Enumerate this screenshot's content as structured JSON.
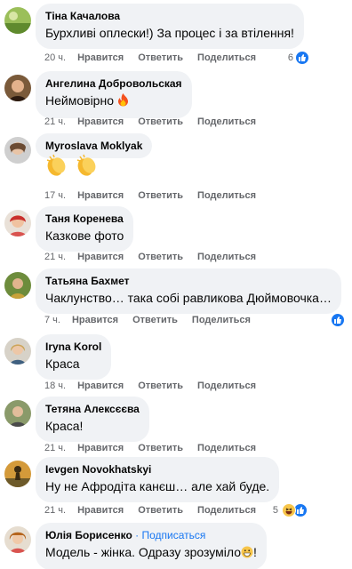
{
  "colors": {
    "bubble_bg": "#f0f2f5",
    "action_text": "#65676b",
    "like_blue": "#1877f2",
    "follow_link": "#1877f2"
  },
  "actions": {
    "like": "Нравится",
    "reply": "Ответить",
    "share": "Поделиться"
  },
  "comments": [
    {
      "author": "Тіна Качалова",
      "text": "Бурхливі оплески!) За процес і за втілення!",
      "time": "20 ч.",
      "reactions_count": "6",
      "reaction_icons": [
        "like-icon"
      ],
      "avatar_icon": "avatar-green-landscape"
    },
    {
      "author": "Ангелина Добровольская",
      "text": "Неймовірно",
      "text_emoji": "fire-icon",
      "time": "21 ч.",
      "avatar_icon": "avatar-woman-dark-hair"
    },
    {
      "author": "Myroslava Moklyak",
      "text": "",
      "text_emoji": "clapping-hands-icon x2",
      "time": "17 ч.",
      "avatar_icon": "avatar-woman-portrait"
    },
    {
      "author": "Таня Коренева",
      "text": "Казкове фото",
      "time": "21 ч.",
      "avatar_icon": "avatar-woman-red"
    },
    {
      "author": "Татьяна Бахмет",
      "text": "Чаклунство… така собі равликова Дюймовочка…",
      "time": "7 ч.",
      "reaction_icons": [
        "like-icon"
      ],
      "avatar_icon": "avatar-woman-outdoor"
    },
    {
      "author": "Iryna Korol",
      "text": "Краса",
      "time": "18 ч.",
      "avatar_icon": "avatar-woman-blonde"
    },
    {
      "author": "Тетяна Алексєєва",
      "text": "Краса!",
      "time": "21 ч.",
      "avatar_icon": "avatar-woman-garden"
    },
    {
      "author": "Ievgen Novokhatskyi",
      "text": "Ну не Афродіта канєш… але хай буде.",
      "time": "21 ч.",
      "reactions_count": "5",
      "reaction_icons": [
        "haha-icon",
        "like-icon"
      ],
      "avatar_icon": "avatar-man-sunset"
    },
    {
      "author": "Юлія Борисенко",
      "follow_separator": " · ",
      "follow_label": "Подписаться",
      "text": "Модель - жінка. Одразу зрозуміло",
      "text_suffix": "!",
      "text_emoji": "grinning-face-icon",
      "avatar_icon": "avatar-woman-curly"
    }
  ]
}
